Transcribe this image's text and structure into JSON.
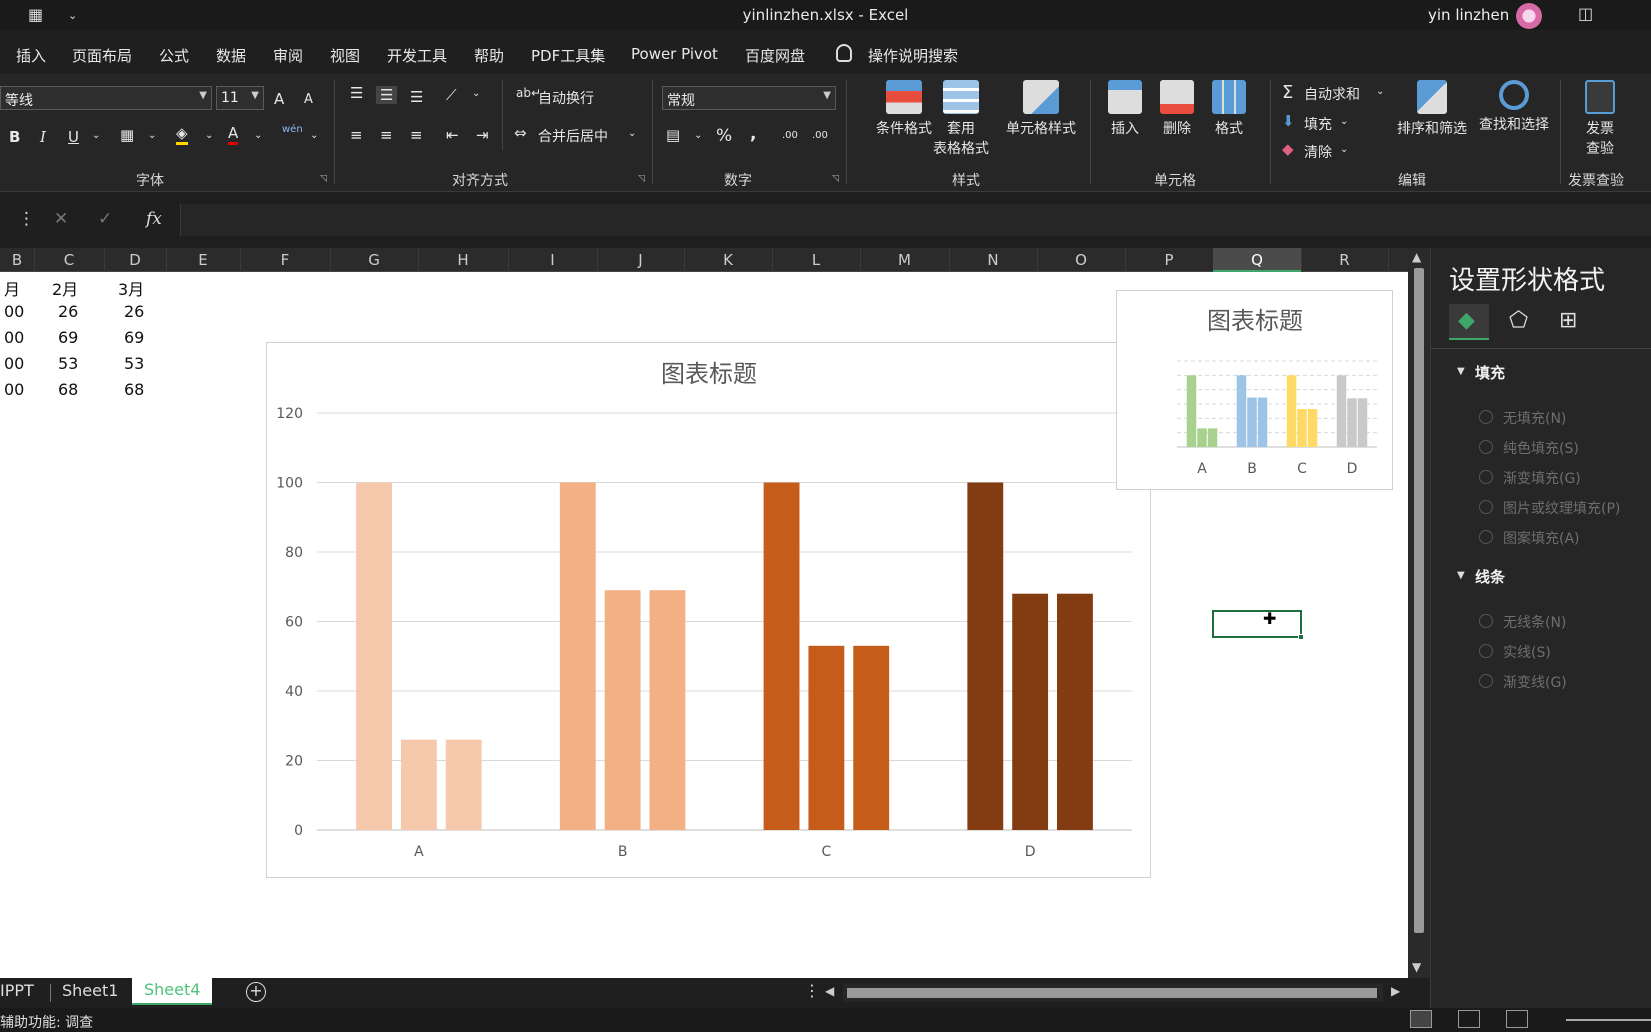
{
  "window": {
    "title": "yinlinzhen.xlsx  -  Excel",
    "user": "yin linzhen"
  },
  "tabs": [
    {
      "label": "插入"
    },
    {
      "label": "页面布局"
    },
    {
      "label": "公式"
    },
    {
      "label": "数据"
    },
    {
      "label": "审阅"
    },
    {
      "label": "视图"
    },
    {
      "label": "开发工具"
    },
    {
      "label": "帮助"
    },
    {
      "label": "PDF工具集"
    },
    {
      "label": "Power Pivot"
    },
    {
      "label": "百度网盘"
    },
    {
      "label": "操作说明搜索"
    }
  ],
  "ribbon": {
    "font_name": "等线",
    "font_size": "11",
    "bold": "B",
    "italic": "I",
    "underline": "U",
    "font_color_glyph": "A",
    "phonetic_glyph": "wén",
    "increase_font": "A",
    "decrease_font": "A",
    "wrap_text": "自动换行",
    "merge_center": "合并后居中",
    "number_format": "常规",
    "percent": "%",
    "comma": ",",
    "inc_decimal": ".00",
    "dec_decimal": ".00",
    "cond_format": "条件格式",
    "table_format_1": "套用",
    "table_format_2": "表格格式",
    "cell_style": "单元格样式",
    "insert": "插入",
    "delete": "删除",
    "format": "格式",
    "autosum": "自动求和",
    "fill": "填充",
    "clear": "清除",
    "sort_filter": "排序和筛选",
    "find_select": "查找和选择",
    "invoice_1": "发票",
    "invoice_2": "查验",
    "groups": {
      "font": "字体",
      "align": "对齐方式",
      "number": "数字",
      "styles": "样式",
      "cells": "单元格",
      "editing": "编辑",
      "invoice": "发票查验"
    }
  },
  "formula_bar": {
    "fx": "fx"
  },
  "columns": [
    "B",
    "C",
    "D",
    "E",
    "F",
    "G",
    "H",
    "I",
    "J",
    "K",
    "L",
    "M",
    "N",
    "O",
    "P",
    "Q",
    "R"
  ],
  "selected_column": "Q",
  "cells": {
    "header": [
      "月",
      "2月",
      "3月"
    ],
    "rows": [
      [
        "00",
        "26",
        "26"
      ],
      [
        "00",
        "69",
        "69"
      ],
      [
        "00",
        "53",
        "53"
      ],
      [
        "00",
        "68",
        "68"
      ]
    ]
  },
  "sheet_tabs": [
    "IPPT",
    "Sheet1",
    "Sheet4"
  ],
  "active_sheet": "Sheet4",
  "status": {
    "text": "辅助功能: 调查"
  },
  "pane": {
    "title": "设置形状格式",
    "fill_section": "填充",
    "fill_options": [
      "无填充(N)",
      "纯色填充(S)",
      "渐变填充(G)",
      "图片或纹理填充(P)",
      "图案填充(A)"
    ],
    "line_section": "线条",
    "line_options": [
      "无线条(N)",
      "实线(S)",
      "渐变线(G)"
    ]
  },
  "chart_data": [
    {
      "type": "bar",
      "title": "图表标题",
      "categories": [
        "A",
        "B",
        "C",
        "D"
      ],
      "series": [
        {
          "values": [
            100,
            100,
            100,
            100
          ]
        },
        {
          "values": [
            26,
            69,
            53,
            68
          ]
        },
        {
          "values": [
            26,
            69,
            53,
            68
          ]
        }
      ],
      "ylim": [
        0,
        120
      ],
      "yticks": [
        0,
        20,
        40,
        60,
        80,
        100,
        120
      ],
      "grid": true,
      "category_colors": [
        "#f6c8ac",
        "#f2b084",
        "#c65c1a",
        "#833c11"
      ]
    },
    {
      "type": "bar",
      "title": "图表标题",
      "categories": [
        "A",
        "B",
        "C",
        "D"
      ],
      "series": [
        {
          "values": [
            100,
            100,
            100,
            100
          ]
        },
        {
          "values": [
            26,
            69,
            53,
            68
          ]
        },
        {
          "values": [
            26,
            69,
            53,
            68
          ]
        }
      ],
      "ylim": [
        0,
        120
      ],
      "grid": true,
      "category_colors": [
        "#a9d18e",
        "#9dc3e6",
        "#ffd966",
        "#c9c9c9"
      ]
    }
  ]
}
